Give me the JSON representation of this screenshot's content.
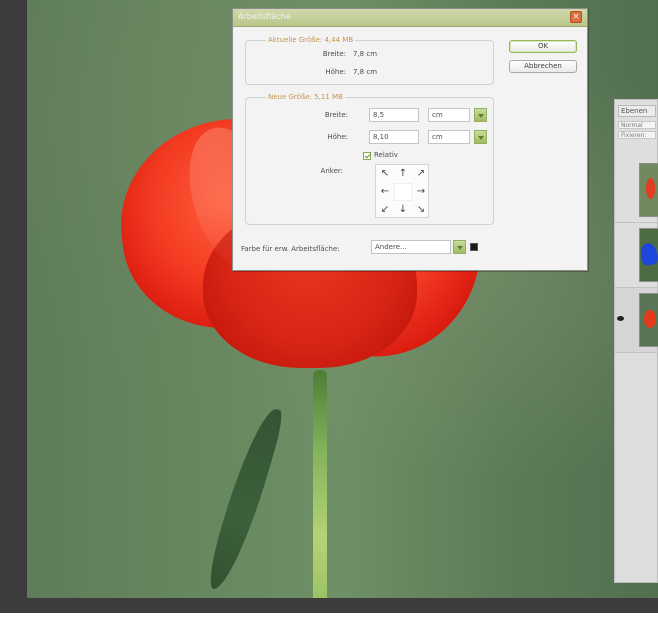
{
  "dialog": {
    "title": "Arbeitsfläche",
    "close_label": "×",
    "current_size": {
      "label": "Aktuelle Größe: 4,44 MB",
      "width_label": "Breite:",
      "width_value": "7,8 cm",
      "height_label": "Höhe:",
      "height_value": "7,8 cm"
    },
    "new_size": {
      "label": "Neue Größe: 5,11 MB",
      "width_label": "Breite:",
      "width_value": "8,5",
      "width_unit": "cm",
      "height_label": "Höhe:",
      "height_value": "8,10",
      "height_unit": "cm",
      "relative_label": "Relativ",
      "anchor_label": "Anker:"
    },
    "buttons": {
      "ok": "OK",
      "cancel": "Abbrechen"
    },
    "canvas_color": {
      "label": "Farbe für erw. Arbeitsfläche:",
      "value": "Andere..."
    }
  },
  "layers_panel": {
    "tab_label": "Ebenen",
    "blend_mode": "Normal",
    "fill_label": "Fixieren:"
  },
  "anchor_arrows": [
    "↖",
    "↑",
    "↗",
    "←",
    "",
    "→",
    "↙",
    "↓",
    "↘"
  ],
  "status_bar": {
    "text": ""
  },
  "colors": {
    "titlebar": "#b9c68a",
    "accent_green": "#9dbd61",
    "poppy_red": "#e5361f",
    "background_green": "#66865f"
  }
}
